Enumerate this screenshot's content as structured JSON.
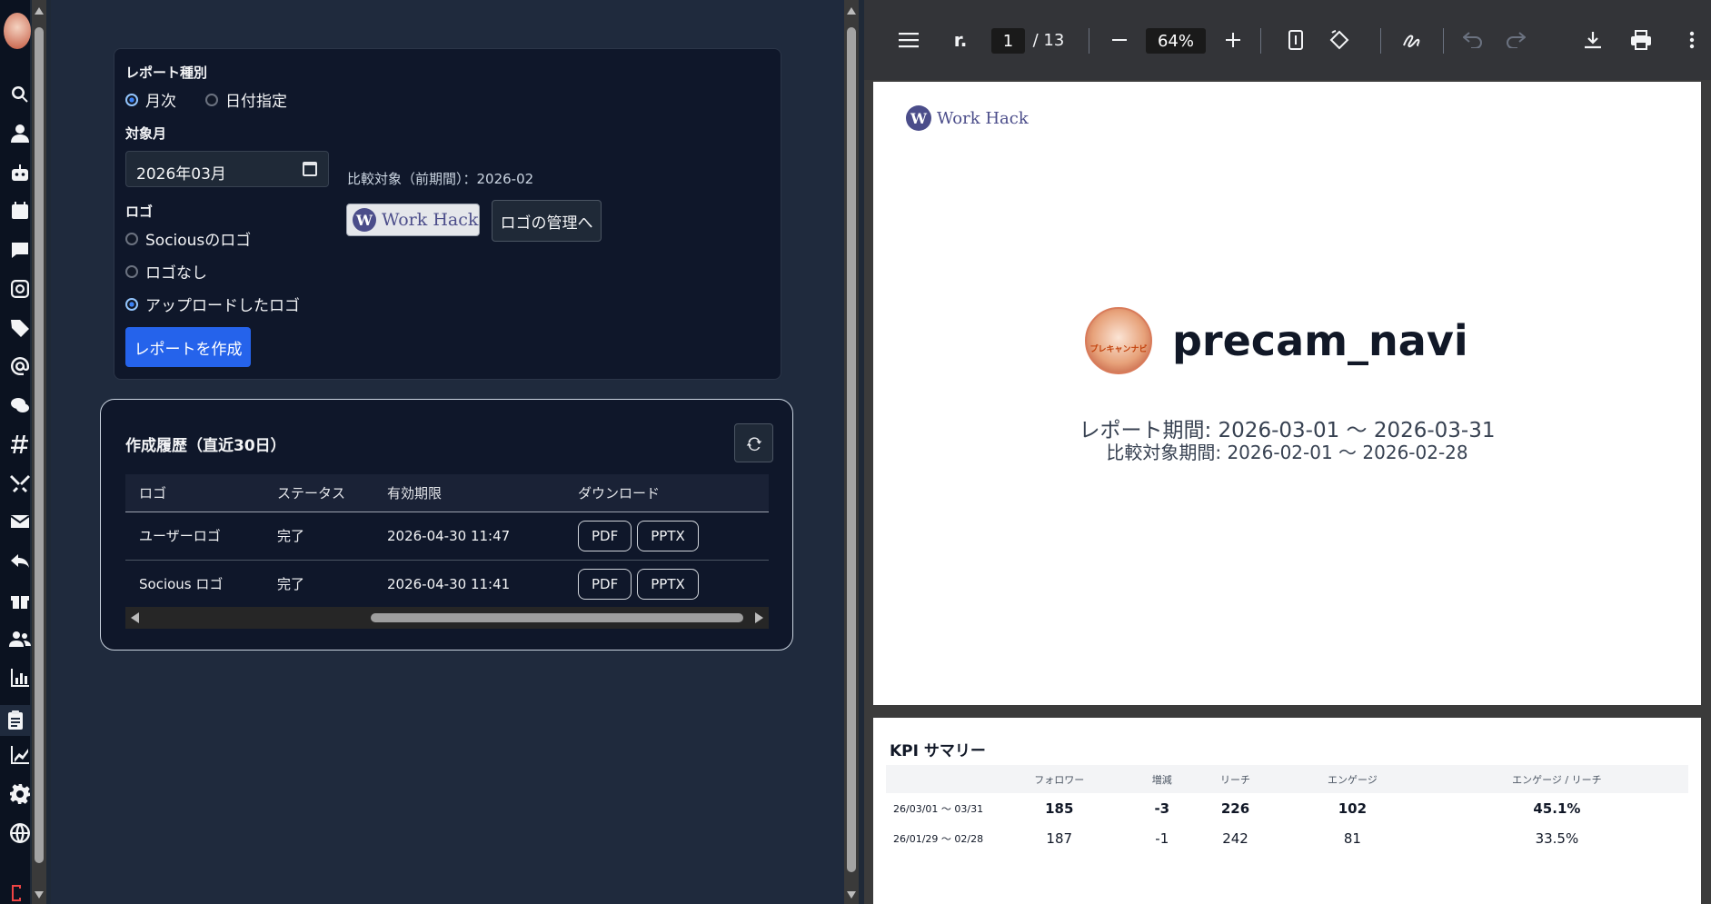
{
  "report_form": {
    "report_type_label": "レポート種別",
    "report_type_options": [
      "月次",
      "日付指定"
    ],
    "report_type_selected": "月次",
    "target_month_label": "対象月",
    "target_month_value": "2026年03月",
    "comparison_text": "比較対象（前期間）：2026-02",
    "logo_label": "ロゴ",
    "logo_options": [
      "Sociousのロゴ",
      "ロゴなし",
      "アップロードしたロゴ"
    ],
    "logo_selected": "アップロードしたロゴ",
    "uploaded_logo_text": "Work Hack",
    "manage_logo_button": "ロゴの管理へ",
    "create_button": "レポートを作成"
  },
  "history": {
    "title": "作成履歴（直近30日）",
    "columns": [
      "ロゴ",
      "ステータス",
      "有効期限",
      "ダウンロード"
    ],
    "rows": [
      {
        "logo": "ユーザーロゴ",
        "status": "完了",
        "expires": "2026-04-30 11:47",
        "pdf": "PDF",
        "pptx": "PPTX"
      },
      {
        "logo": "Socious ロゴ",
        "status": "完了",
        "expires": "2026-04-30 11:41",
        "pdf": "PDF",
        "pptx": "PPTX"
      }
    ]
  },
  "viewer": {
    "menu_text": "r.",
    "page_current": "1",
    "page_total": "/ 13",
    "zoom": "64%",
    "page1": {
      "logo_text": "Work Hack",
      "account_name": "precam_navi",
      "avatar_text": "プレキャンナビ",
      "report_period": "レポート期間:  2026-03-01  〜 2026-03-31",
      "comparison_period": "比較対象期間:  2026-02-01  〜 2026-02-28"
    },
    "page2": {
      "kpi_title": "KPI サマリー",
      "kpi_columns": [
        "",
        "フォロワー",
        "増減",
        "リーチ",
        "エンゲージ",
        "エンゲージ / リーチ"
      ],
      "kpi_rows": [
        [
          "26/03/01 〜 03/31",
          "185",
          "-3",
          "226",
          "102",
          "45.1%"
        ],
        [
          "26/01/29 〜 02/28",
          "187",
          "-1",
          "242",
          "81",
          "33.5%"
        ]
      ]
    }
  },
  "colors": {
    "primary": "#2563eb",
    "kpi_red": "#dc2626",
    "kpi_blue": "#2b7bd8"
  }
}
